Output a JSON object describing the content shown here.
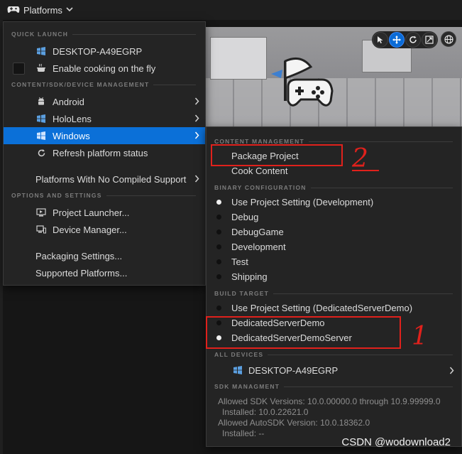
{
  "topbar": {
    "platforms_label": "Platforms"
  },
  "viewport": {
    "tool_icons": [
      "select-icon",
      "move-icon",
      "rotate-icon",
      "scale-icon",
      "globe-icon"
    ]
  },
  "menu": {
    "quick_launch_header": "QUICK LAUNCH",
    "desktop_label": "DESKTOP-A49EGRP",
    "cook_fly_label": "Enable cooking on the fly",
    "content_header": "CONTENT/SDK/DEVICE MANAGEMENT",
    "android_label": "Android",
    "hololens_label": "HoloLens",
    "windows_label": "Windows",
    "refresh_label": "Refresh platform status",
    "no_compiled_label": "Platforms With No Compiled Support",
    "options_header": "OPTIONS AND SETTINGS",
    "launcher_label": "Project Launcher...",
    "device_manager_label": "Device Manager...",
    "packaging_settings_label": "Packaging Settings...",
    "supported_platforms_label": "Supported Platforms..."
  },
  "submenu": {
    "content_header": "CONTENT MANAGEMENT",
    "package_label": "Package Project",
    "cook_label": "Cook Content",
    "binary_header": "BINARY CONFIGURATION",
    "binary_items": [
      {
        "label": "Use Project Setting (Development)",
        "selected": true
      },
      {
        "label": "Debug",
        "selected": false
      },
      {
        "label": "DebugGame",
        "selected": false
      },
      {
        "label": "Development",
        "selected": false
      },
      {
        "label": "Test",
        "selected": false
      },
      {
        "label": "Shipping",
        "selected": false
      }
    ],
    "build_header": "BUILD TARGET",
    "build_items": [
      {
        "label": "Use Project Setting (DedicatedServerDemo)",
        "selected": false
      },
      {
        "label": "DedicatedServerDemo",
        "selected": false
      },
      {
        "label": "DedicatedServerDemoServer",
        "selected": true
      }
    ],
    "devices_header": "ALL DEVICES",
    "device_label": "DESKTOP-A49EGRP",
    "sdk_header": "SDK MANAGMENT",
    "sdk_lines": [
      "Allowed SDK Versions: 10.0.00000.0 through 10.9.99999.0",
      " Installed: 10.0.22621.0",
      "Allowed AutoSDK Version: 10.0.18362.0",
      " Installed: --"
    ]
  },
  "annotations": {
    "mark_2": "2",
    "mark_1": "1"
  },
  "watermark": "CSDN @wodownload2",
  "colors": {
    "highlight": "#0b70d8",
    "annotation": "#e0211c"
  }
}
